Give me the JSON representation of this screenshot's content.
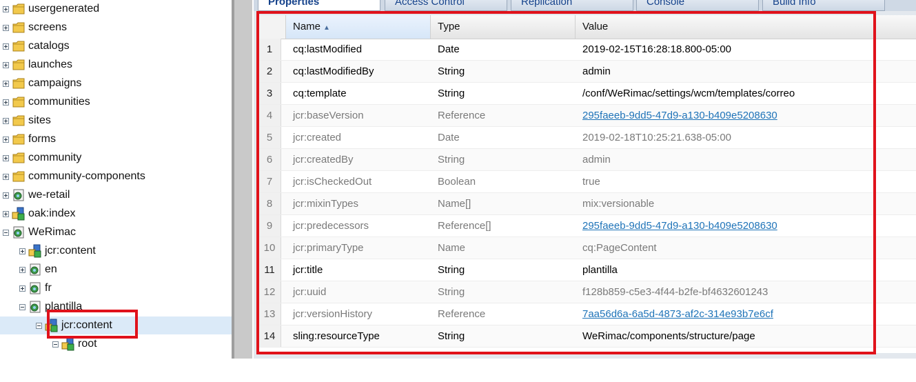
{
  "tree": {
    "items": [
      {
        "label": "usergenerated",
        "icon": "folder-icon",
        "expander": "plus"
      },
      {
        "label": "screens",
        "icon": "folder-icon",
        "expander": "plus"
      },
      {
        "label": "catalogs",
        "icon": "folder-icon",
        "expander": "plus"
      },
      {
        "label": "launches",
        "icon": "folder-icon",
        "expander": "plus"
      },
      {
        "label": "campaigns",
        "icon": "folder-icon",
        "expander": "plus"
      },
      {
        "label": "communities",
        "icon": "folder-icon",
        "expander": "plus"
      },
      {
        "label": "sites",
        "icon": "folder-icon",
        "expander": "plus"
      },
      {
        "label": "forms",
        "icon": "folder-icon",
        "expander": "plus"
      },
      {
        "label": "community",
        "icon": "folder-icon",
        "expander": "plus"
      },
      {
        "label": "community-components",
        "icon": "folder-icon",
        "expander": "plus"
      },
      {
        "label": "we-retail",
        "icon": "page-node-icon",
        "expander": "plus"
      },
      {
        "label": "oak:index",
        "icon": "node-icon",
        "expander": "plus"
      },
      {
        "label": "WeRimac",
        "icon": "page-node-icon",
        "expander": "minus"
      },
      {
        "label": "jcr:content",
        "icon": "node-icon",
        "expander": "plus"
      },
      {
        "label": "en",
        "icon": "page-node-icon",
        "expander": "plus"
      },
      {
        "label": "fr",
        "icon": "page-node-icon",
        "expander": "plus"
      },
      {
        "label": "plantilla",
        "icon": "page-node-icon",
        "expander": "minus"
      },
      {
        "label": "jcr:content",
        "icon": "node-icon",
        "expander": "minus",
        "selected": true
      },
      {
        "label": "root",
        "icon": "node-icon",
        "expander": "minus"
      }
    ]
  },
  "tabs": [
    {
      "label": "Properties",
      "active": true
    },
    {
      "label": "Access Control",
      "active": false
    },
    {
      "label": "Replication",
      "active": false
    },
    {
      "label": "Console",
      "active": false
    },
    {
      "label": "Build Info",
      "active": false
    }
  ],
  "grid": {
    "columns": {
      "name": "Name",
      "type": "Type",
      "value": "Value"
    },
    "sort_indicator": "▲",
    "rows": [
      {
        "n": "1",
        "name": "cq:lastModified",
        "type": "Date",
        "value": "2019-02-15T16:28:18.800-05:00",
        "protected": false,
        "link": false
      },
      {
        "n": "2",
        "name": "cq:lastModifiedBy",
        "type": "String",
        "value": "admin",
        "protected": false,
        "link": false
      },
      {
        "n": "3",
        "name": "cq:template",
        "type": "String",
        "value": "/conf/WeRimac/settings/wcm/templates/correo",
        "protected": false,
        "link": false
      },
      {
        "n": "4",
        "name": "jcr:baseVersion",
        "type": "Reference",
        "value": "295faeeb-9dd5-47d9-a130-b409e5208630",
        "protected": true,
        "link": true
      },
      {
        "n": "5",
        "name": "jcr:created",
        "type": "Date",
        "value": "2019-02-18T10:25:21.638-05:00",
        "protected": true,
        "link": false
      },
      {
        "n": "6",
        "name": "jcr:createdBy",
        "type": "String",
        "value": "admin",
        "protected": true,
        "link": false
      },
      {
        "n": "7",
        "name": "jcr:isCheckedOut",
        "type": "Boolean",
        "value": "true",
        "protected": true,
        "link": false
      },
      {
        "n": "8",
        "name": "jcr:mixinTypes",
        "type": "Name[]",
        "value": "mix:versionable",
        "protected": true,
        "link": false
      },
      {
        "n": "9",
        "name": "jcr:predecessors",
        "type": "Reference[]",
        "value": "295faeeb-9dd5-47d9-a130-b409e5208630",
        "protected": true,
        "link": true
      },
      {
        "n": "10",
        "name": "jcr:primaryType",
        "type": "Name",
        "value": "cq:PageContent",
        "protected": true,
        "link": false
      },
      {
        "n": "11",
        "name": "jcr:title",
        "type": "String",
        "value": "plantilla",
        "protected": false,
        "link": false
      },
      {
        "n": "12",
        "name": "jcr:uuid",
        "type": "String",
        "value": "f128b859-c5e3-4f44-b2fe-bf4632601243",
        "protected": true,
        "link": false
      },
      {
        "n": "13",
        "name": "jcr:versionHistory",
        "type": "Reference",
        "value": "7aa56d6a-6a5d-4873-af2c-314e93b7e6cf",
        "protected": true,
        "link": true
      },
      {
        "n": "14",
        "name": "sling:resourceType",
        "type": "String",
        "value": "WeRimac/components/structure/page",
        "protected": false,
        "link": false
      }
    ]
  },
  "colors": {
    "highlight": "#e0121b",
    "selection": "#dbeaf8",
    "link": "#1e73b8"
  }
}
